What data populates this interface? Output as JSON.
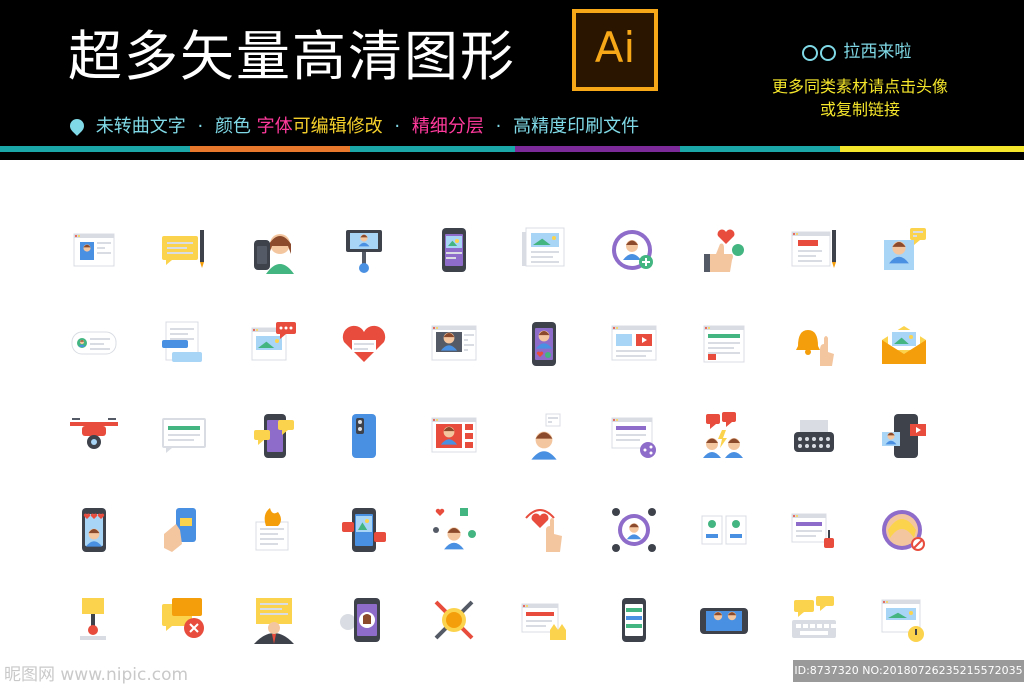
{
  "header": {
    "title": "超多矢量高清图形",
    "ai_logo": "Ai",
    "features": {
      "f1": "未转曲文字",
      "sep": "·",
      "f2": "颜色",
      "f3a": "字体",
      "f3b": "可编辑修改",
      "f4": "精细分层",
      "f5": "高精度印刷文件"
    },
    "brand": "拉西来啦",
    "promo_line1": "更多同类素材请点击头像",
    "promo_line2": "或复制链接"
  },
  "watermark": {
    "site": "昵图网 www.nipic.com",
    "id_text": "ID:8737320 NO:20180726235215572035"
  },
  "colors": {
    "header_bg": "#000000",
    "accent_cyan": "#7fd9e6",
    "accent_pink": "#ff3a9c",
    "accent_yellow": "#f5d02b",
    "ai_orange": "#f7a818"
  },
  "icons": [
    "profile-card-icon",
    "sticky-note-pencil-icon",
    "phone-woman-icon",
    "selfie-stick-icon",
    "smartphone-image-icon",
    "image-documents-icon",
    "add-user-icon",
    "like-heart-add-icon",
    "document-pencil-icon",
    "user-chat-icon",
    "contact-card-icon",
    "chat-bubbles-icon",
    "image-message-icon",
    "heart-message-icon",
    "video-call-screen-icon",
    "phone-user-like-icon",
    "video-webpage-icon",
    "shopping-webpage-icon",
    "notification-bell-icon",
    "email-image-icon",
    "drone-camera-icon",
    "message-bubble-icon",
    "phone-chat-icon",
    "phone-cover-icon",
    "video-gallery-icon",
    "user-thinking-icon",
    "share-webpage-icon",
    "group-chat-alert-icon",
    "typewriter-icon",
    "phone-video-share-icon",
    "phone-hearts-icon",
    "hand-phone-mail-icon",
    "burning-message-icon",
    "phone-image-likes-icon",
    "user-share-like-icon",
    "touch-heart-icon",
    "user-network-icon",
    "contact-cards-icon",
    "webpage-coffee-icon",
    "user-blocked-icon",
    "sign-post-icon",
    "messages-cancel-icon",
    "businessman-sign-icon",
    "phone-podcast-icon",
    "medal-tools-icon",
    "webpage-crown-icon",
    "phone-chat-list-icon",
    "landscape-phone-video-icon",
    "keyboard-message-icon",
    "webpage-timer-icon"
  ]
}
